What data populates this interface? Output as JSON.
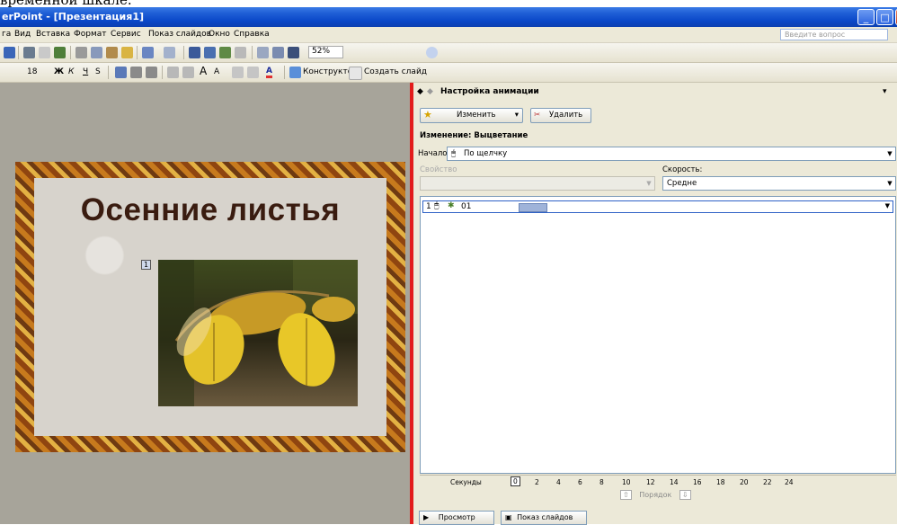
{
  "caption": {
    "text": "временной шкале."
  },
  "window": {
    "title": "erPoint - [Презентация1]"
  },
  "menu": {
    "items": [
      "га",
      "Вид",
      "Вставка",
      "Формат",
      "Сервис",
      "Показ слайдов",
      "Окно",
      "Справка"
    ],
    "help_placeholder": "Введите вопрос"
  },
  "toolbar1": {
    "zoom": "52%"
  },
  "toolbar2": {
    "font_size": "18",
    "design_label": "Конструктор",
    "new_slide_label": "Создать слайд"
  },
  "slide": {
    "title": "Осенние листья",
    "anim_tag": "1"
  },
  "taskpane": {
    "title": "Настройка анимации",
    "change_button": "Изменить",
    "delete_button": "Удалить",
    "effect_caption": "Изменение: Выцветание",
    "start_label": "Начало:",
    "start_value": "По щелчку",
    "property_label": "Свойство",
    "speed_label": "Скорость:",
    "speed_value": "Средне",
    "anim_item_index": "1",
    "anim_item_name": "01",
    "timeline_label": "Секунды",
    "timeline_ticks": [
      "0",
      "2",
      "4",
      "6",
      "8",
      "10",
      "12",
      "14",
      "16",
      "18",
      "20",
      "22",
      "24"
    ],
    "order_label": "Порядок",
    "play_button": "Просмотр",
    "slideshow_button": "Показ слайдов"
  },
  "colors": {
    "title_bar": "#0a47c8",
    "arrow": "#ee1d1d",
    "divider": "#e21c1c",
    "slide_title": "#3a1c10"
  },
  "icons": [
    "minimize-icon",
    "maximize-icon",
    "close-icon",
    "star-icon",
    "delete-icon",
    "mouse-icon",
    "play-icon",
    "slideshow-icon"
  ]
}
